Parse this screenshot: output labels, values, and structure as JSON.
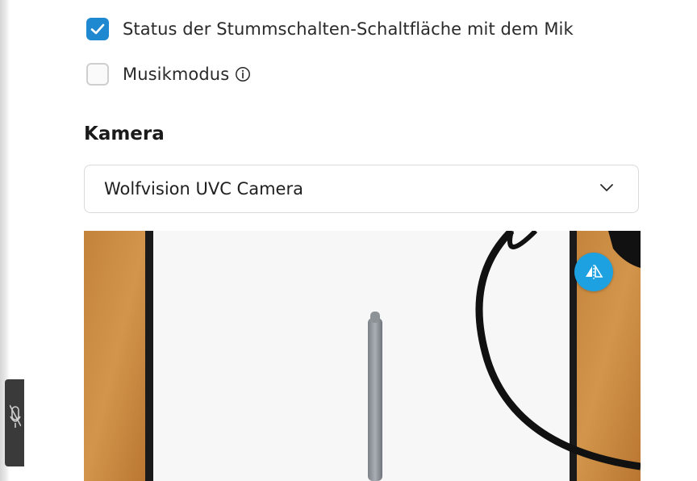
{
  "audio": {
    "sync_mute": {
      "label": "Status der Stummschalten-Schaltfläche mit dem Mik",
      "checked": true
    },
    "music_mode": {
      "label": "Musikmodus",
      "checked": false
    }
  },
  "camera": {
    "section_title": "Kamera",
    "selected_device": "Wolfvision UVC Camera",
    "flip_icon": "flip-horizontal-icon"
  },
  "colors": {
    "accent": "#1e88d0",
    "flip_button": "#1da1e0",
    "wood": "#c98a3c"
  },
  "icons": {
    "info": "info-icon",
    "dropdown": "chevron-down-icon",
    "mic": "microphone-off-icon"
  }
}
